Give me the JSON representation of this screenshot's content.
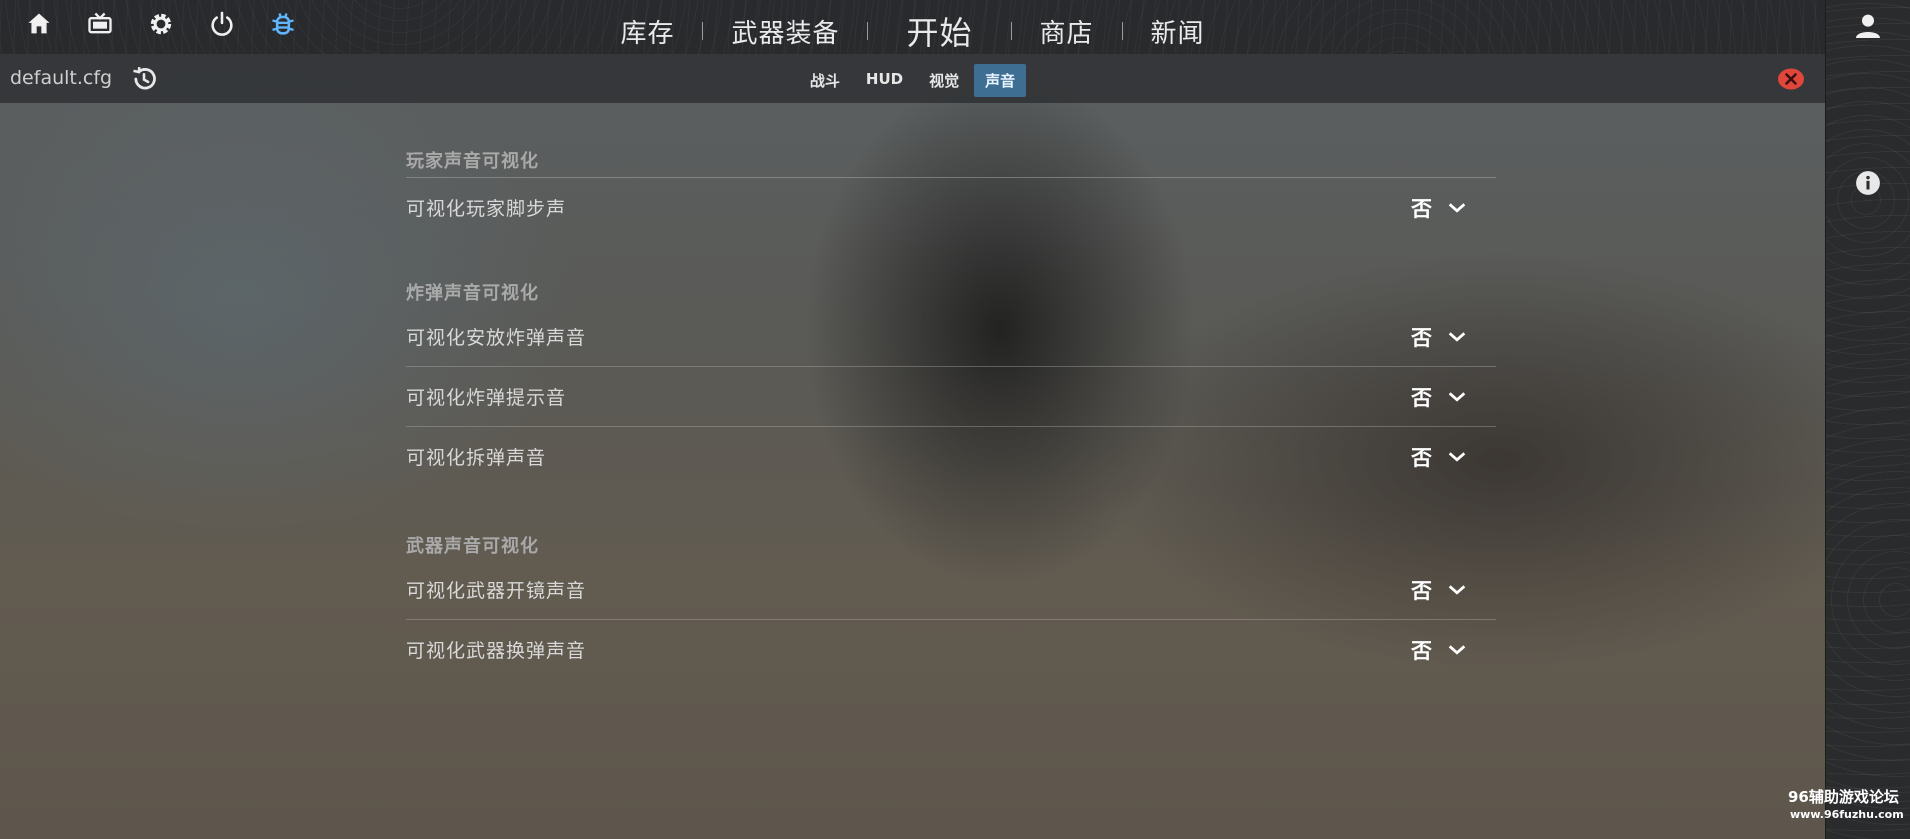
{
  "topbar": {
    "icons": [
      "home-icon",
      "tv-icon",
      "gear-icon",
      "power-icon",
      "bug-icon"
    ],
    "nav": [
      "库存",
      "武器装备",
      "开始",
      "商店",
      "新闻"
    ]
  },
  "subbar": {
    "config_name": "default.cfg",
    "tabs": [
      "战斗",
      "HUD",
      "视觉",
      "声音"
    ],
    "active_tab": "声音"
  },
  "sections": [
    {
      "title": "玩家声音可视化",
      "rows": [
        {
          "label": "可视化玩家脚步声",
          "value": "否"
        }
      ]
    },
    {
      "title": "炸弹声音可视化",
      "rows": [
        {
          "label": "可视化安放炸弹声音",
          "value": "否"
        },
        {
          "label": "可视化炸弹提示音",
          "value": "否"
        },
        {
          "label": "可视化拆弹声音",
          "value": "否"
        }
      ]
    },
    {
      "title": "武器声音可视化",
      "rows": [
        {
          "label": "可视化武器开镜声音",
          "value": "否"
        },
        {
          "label": "可视化武器换弹声音",
          "value": "否"
        }
      ]
    }
  ],
  "watermark": {
    "line1": "96辅助游戏论坛",
    "line2": "www.96fuzhu.com"
  },
  "colors": {
    "accent_tab": "#3e6e92",
    "bug_icon": "#5fb6ff",
    "close_icon": "#e0463c"
  }
}
